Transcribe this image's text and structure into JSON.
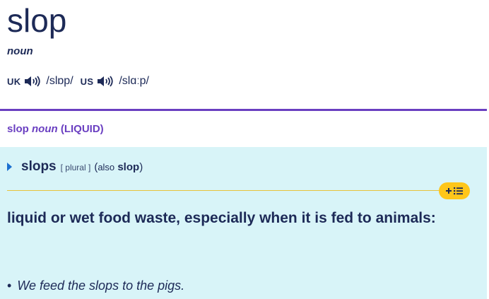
{
  "entry": {
    "headword": "slop",
    "part_of_speech": "noun"
  },
  "pronunciations": [
    {
      "region": "UK",
      "ipa": "/slɒp/"
    },
    {
      "region": "US",
      "ipa": "/slɑːp/"
    }
  ],
  "sense": {
    "word": "slop",
    "pos": "noun",
    "guideword": "(LIQUID)",
    "variant": "slops",
    "grammar": "[ plural ]",
    "also_open": "(",
    "also_word": "also",
    "also_variant": "slop",
    "also_close": ")",
    "definition": "liquid or wet food waste, especially when it is fed to animals:",
    "example_bullet": "•",
    "example": "We feed the slops to the pigs."
  },
  "icons": {
    "audio": "speaker-icon",
    "add_to_list": "add-to-wordlist-icon",
    "expand": "triangle-right-icon"
  },
  "colors": {
    "headword": "#1d2a57",
    "accent_purple": "#6a3fc1",
    "definition_bg": "#d8f4f8",
    "list_button": "#ffc61a",
    "rule_yellow": "#e8c33a"
  }
}
